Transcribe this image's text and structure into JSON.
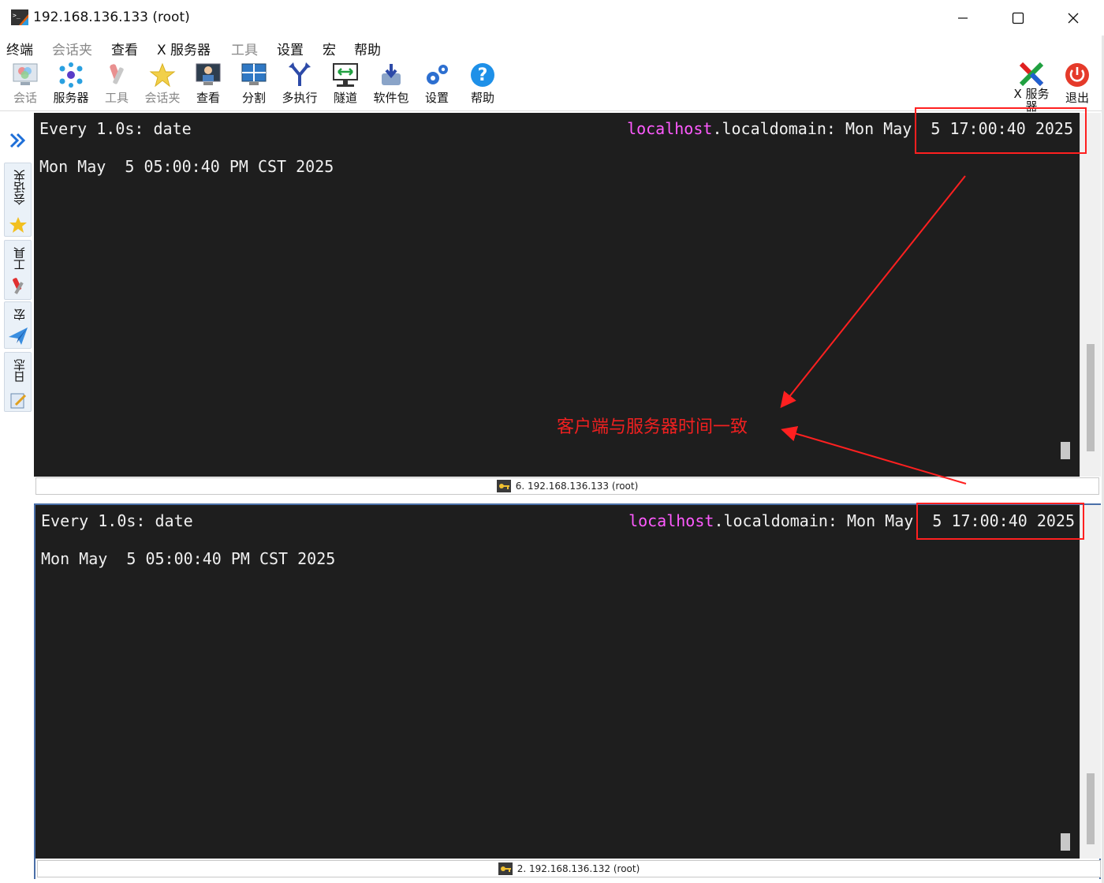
{
  "window": {
    "title": "192.168.136.133 (root)"
  },
  "menu": [
    "终端",
    "会话夹",
    "查看",
    "X 服务器",
    "工具",
    "设置",
    "宏",
    "帮助"
  ],
  "toolbar": {
    "session": "会话",
    "servers": "服务器",
    "tools": "工具",
    "sessions": "会话夹",
    "view": "查看",
    "split": "分割",
    "multiexec": "多执行",
    "tunnel": "隧道",
    "packages": "软件包",
    "settings": "设置",
    "help": "帮助",
    "xserver_line1": "X 服务",
    "xserver_line2": "器",
    "exit": "退出"
  },
  "sidebar": {
    "sessions": "会话夹",
    "tools": "工具",
    "macros": "宏",
    "log": "日志"
  },
  "top_pane": {
    "cmd": "Every 1.0s: date",
    "host_a": "localhost",
    "host_b": ".localdomain: Mon May  5 17:00:40 2025",
    "output": "Mon May  5 05:00:40 PM CST 2025",
    "footer": "6. 192.168.136.133 (root)"
  },
  "bottom_pane": {
    "cmd": "Every 1.0s: date",
    "host_a": "localhost",
    "host_b": ".localdomain: Mon May  5 17:00:40 2025",
    "output": "Mon May  5 05:00:40 PM CST 2025",
    "footer": "2. 192.168.136.132 (root)"
  },
  "annotation": {
    "text": "客户端与服务器时间一致",
    "color": "#f02020"
  }
}
